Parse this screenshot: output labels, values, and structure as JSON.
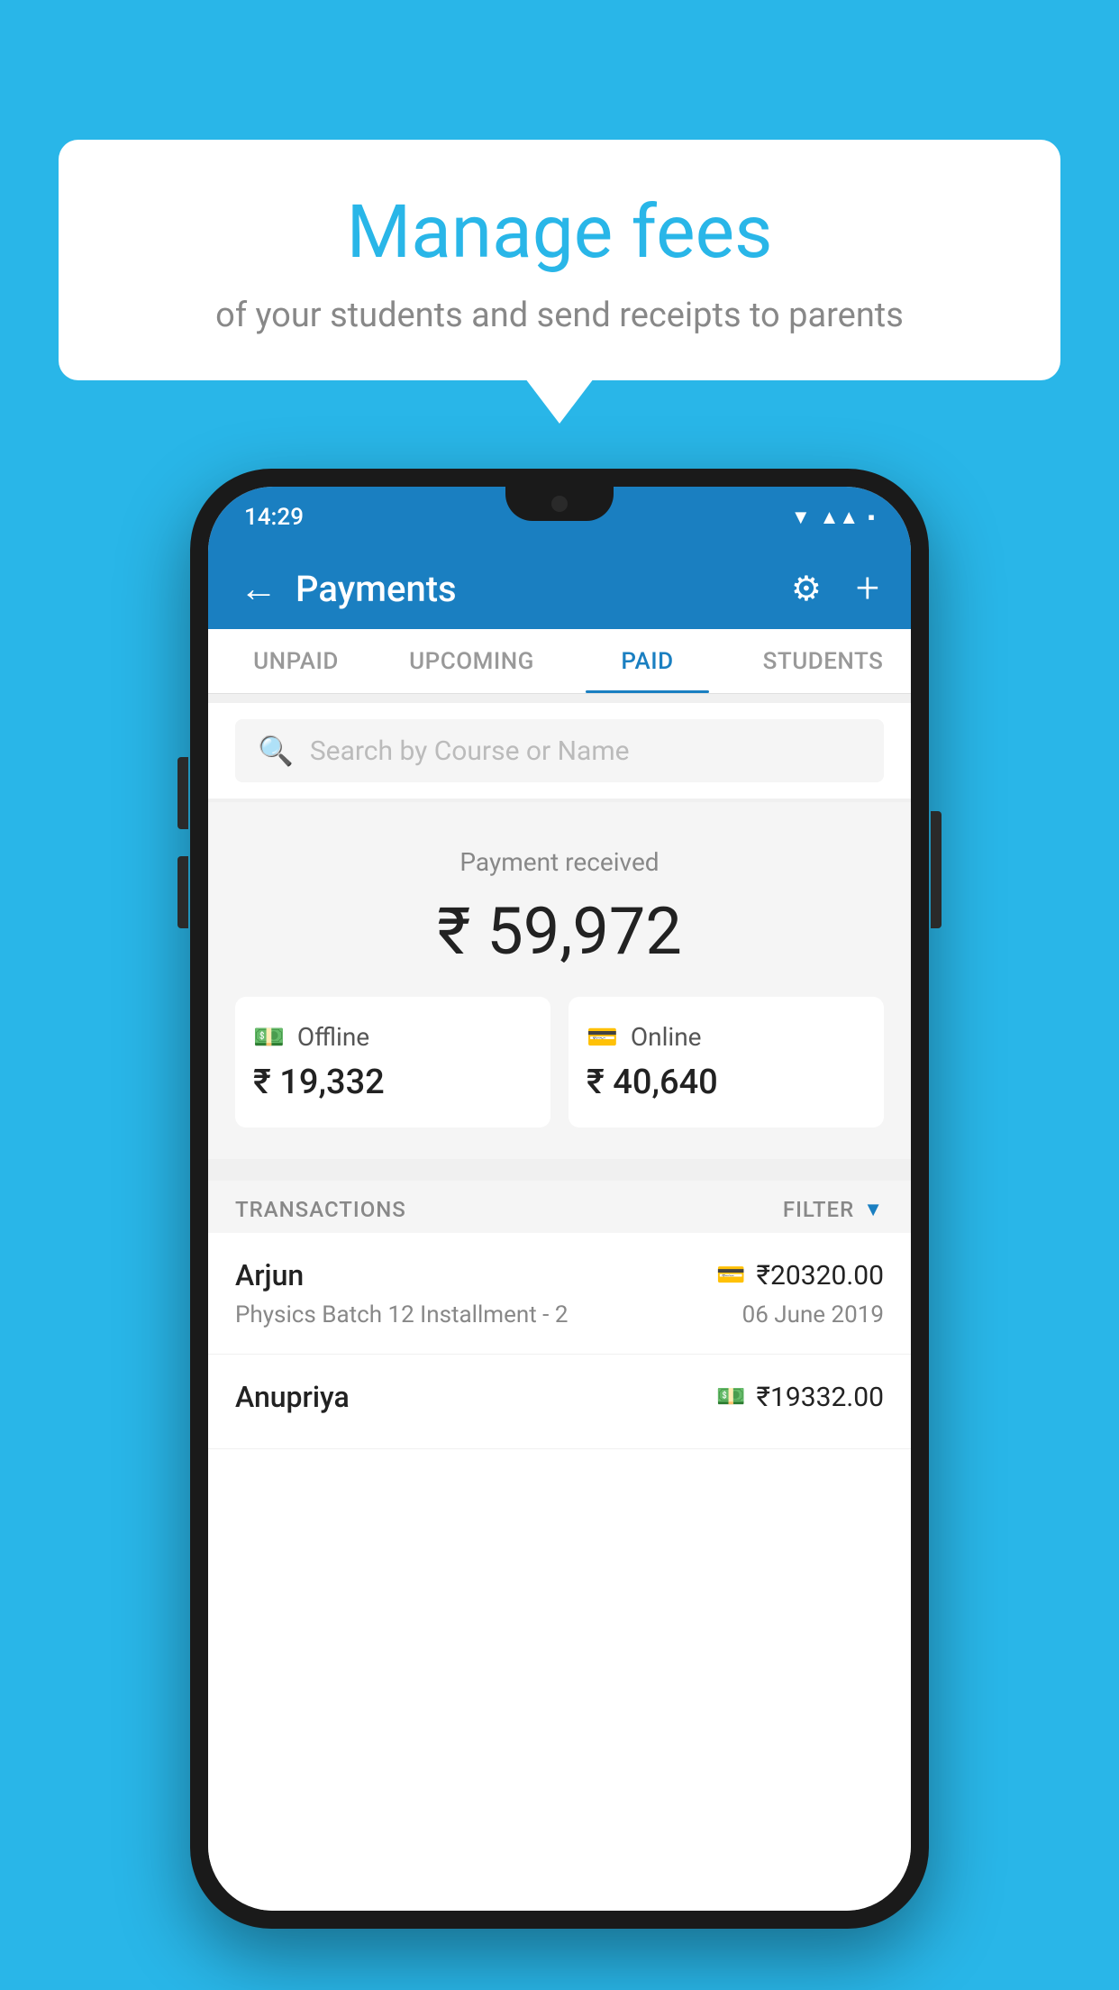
{
  "background_color": "#29b6e8",
  "speech_bubble": {
    "title": "Manage fees",
    "subtitle": "of your students and send receipts to parents"
  },
  "phone": {
    "status_bar": {
      "time": "14:29"
    },
    "header": {
      "title": "Payments",
      "back_label": "←",
      "gear_label": "⚙",
      "plus_label": "+"
    },
    "tabs": [
      {
        "label": "UNPAID",
        "active": false
      },
      {
        "label": "UPCOMING",
        "active": false
      },
      {
        "label": "PAID",
        "active": true
      },
      {
        "label": "STUDENTS",
        "active": false
      }
    ],
    "search": {
      "placeholder": "Search by Course or Name"
    },
    "payment_summary": {
      "label": "Payment received",
      "total": "₹ 59,972",
      "offline": {
        "type": "Offline",
        "amount": "₹ 19,332"
      },
      "online": {
        "type": "Online",
        "amount": "₹ 40,640"
      }
    },
    "transactions": {
      "header_label": "TRANSACTIONS",
      "filter_label": "FILTER",
      "items": [
        {
          "name": "Arjun",
          "course": "Physics Batch 12 Installment - 2",
          "amount": "₹20320.00",
          "date": "06 June 2019",
          "payment_type": "card"
        },
        {
          "name": "Anupriya",
          "course": "",
          "amount": "₹19332.00",
          "date": "",
          "payment_type": "cash"
        }
      ]
    }
  }
}
